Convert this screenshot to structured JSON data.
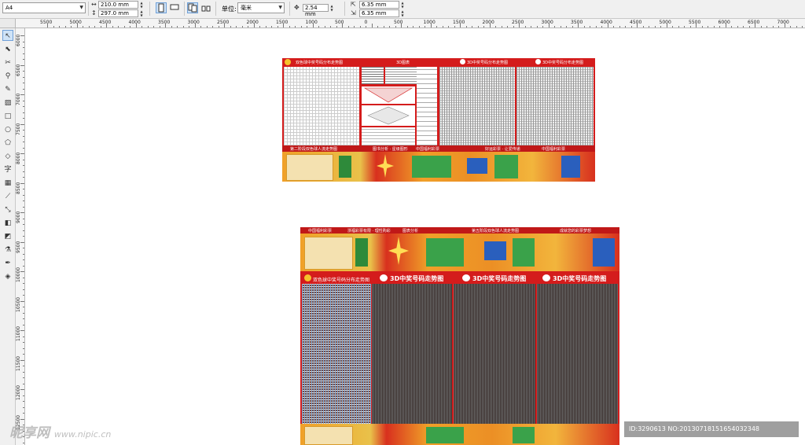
{
  "toolbar": {
    "page_size": "A4",
    "width_value": "210.0 mm",
    "height_value": "297.0 mm",
    "units_label": "单位:",
    "units_value": "毫米",
    "nudge_value": "2.54 mm",
    "dup_x": "6.35 mm",
    "dup_y": "6.35 mm"
  },
  "ruler": {
    "h_labels": [
      "5500",
      "5000",
      "4500",
      "4000",
      "3500",
      "3000",
      "2500",
      "2000",
      "1500",
      "1000",
      "500",
      "0",
      "500",
      "1000",
      "1500",
      "2000",
      "2500",
      "3000",
      "3500",
      "4000",
      "4500",
      "5000",
      "5500",
      "6000",
      "6500",
      "7000"
    ],
    "v_labels": [
      "6000",
      "6500",
      "7000",
      "7500",
      "8000",
      "8500",
      "9000",
      "9500",
      "10000",
      "10500",
      "11000",
      "11500",
      "12000",
      "12500"
    ]
  },
  "artboard_top": {
    "section_titles": [
      "双色球中奖号码分布走势图",
      "3D图表",
      "3D中奖号码分布走势图",
      "3D中奖号码分布走势图"
    ],
    "banner_texts": [
      "第二阶段双色球人流走势图",
      "图书分析 · 星级图形",
      "中国福利彩票",
      "好运彩票 · 让爱传递",
      "中国福利彩票"
    ]
  },
  "artboard_bottom": {
    "banner_texts": [
      "中国福利彩票",
      "浙福彩票有限 · 理性购彩",
      "图表分析",
      "第五阶段双色球人流走势图",
      "成就您的彩票梦想"
    ],
    "section_titles": [
      "双色球中奖号码分布走势图",
      "3D中奖号码走势图",
      "3D中奖号码走势图",
      "3D中奖号码走势图"
    ]
  },
  "watermark": {
    "brand": "昵享网",
    "url": "www.nipic.cn",
    "id_text": "ID:3290613 NO:20130718151654032348"
  },
  "colors": {
    "brand_red": "#d41c1c",
    "banner_orange": "#f0a028",
    "dark_panel": "#3a2e2c",
    "toolbar_bg": "#f0f0f0"
  }
}
